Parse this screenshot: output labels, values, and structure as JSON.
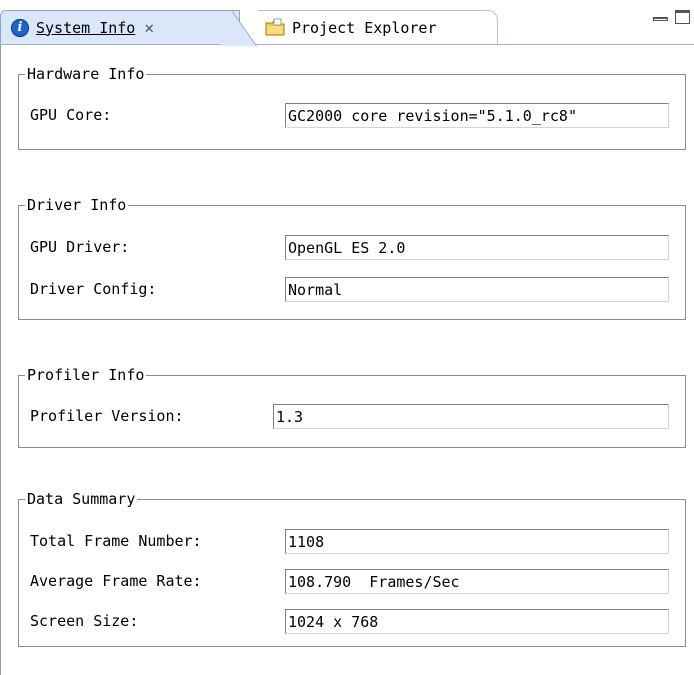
{
  "tabs": {
    "active_label": "System Info",
    "inactive_label": "Project Explorer"
  },
  "hardware": {
    "legend": "Hardware Info",
    "gpu_core_label": "GPU Core:",
    "gpu_core_value": "GC2000 core revision=\"5.1.0_rc8\""
  },
  "driver": {
    "legend": "Driver Info",
    "gpu_driver_label": "GPU Driver:",
    "gpu_driver_value": "OpenGL ES 2.0",
    "driver_config_label": "Driver Config:",
    "driver_config_value": "Normal"
  },
  "profiler": {
    "legend": "Profiler Info",
    "version_label": "Profiler Version:",
    "version_value": "1.3"
  },
  "summary": {
    "legend": "Data Summary",
    "total_frames_label": "Total Frame Number:",
    "total_frames_value": "1108",
    "avg_rate_label": "Average Frame Rate:",
    "avg_rate_value": "108.790  Frames/Sec",
    "screen_size_label": "Screen Size:",
    "screen_size_value": "1024 x 768"
  },
  "icons": {
    "info": "info-icon",
    "close": "close-icon",
    "folder": "folder-icon",
    "minimize": "minimize-icon",
    "maximize": "maximize-icon"
  }
}
